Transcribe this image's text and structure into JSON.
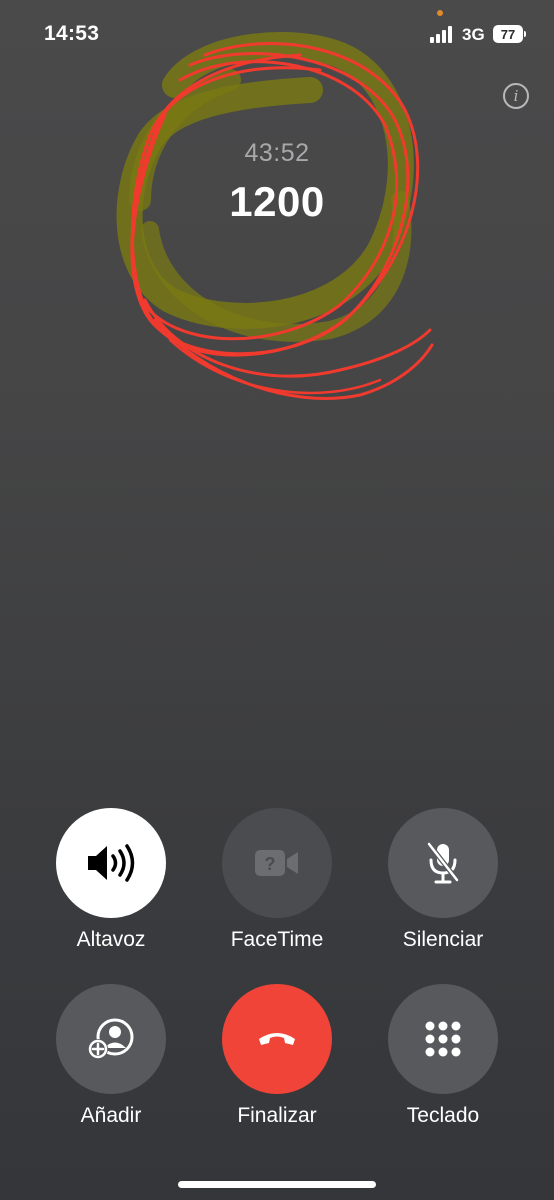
{
  "status_bar": {
    "time": "14:53",
    "network": "3G",
    "battery": "77",
    "privacy_dot_color": "#e08a2c"
  },
  "call": {
    "duration": "43:52",
    "number": "1200"
  },
  "controls": {
    "speaker_label": "Altavoz",
    "facetime_label": "FaceTime",
    "mute_label": "Silenciar",
    "add_label": "Añadir",
    "end_label": "Finalizar",
    "keypad_label": "Teclado"
  },
  "colors": {
    "end_call": "#f04438",
    "button_bg": "#58595c",
    "active_button_bg": "#ffffff",
    "annotation_red": "#f03a2e",
    "annotation_olive": "#7a7a12"
  },
  "icons": {
    "info": "info-icon",
    "speaker": "speaker-icon",
    "facetime": "facetime-unavailable-icon",
    "mute": "microphone-slash-icon",
    "add": "add-person-icon",
    "end": "end-call-icon",
    "keypad": "keypad-icon"
  }
}
